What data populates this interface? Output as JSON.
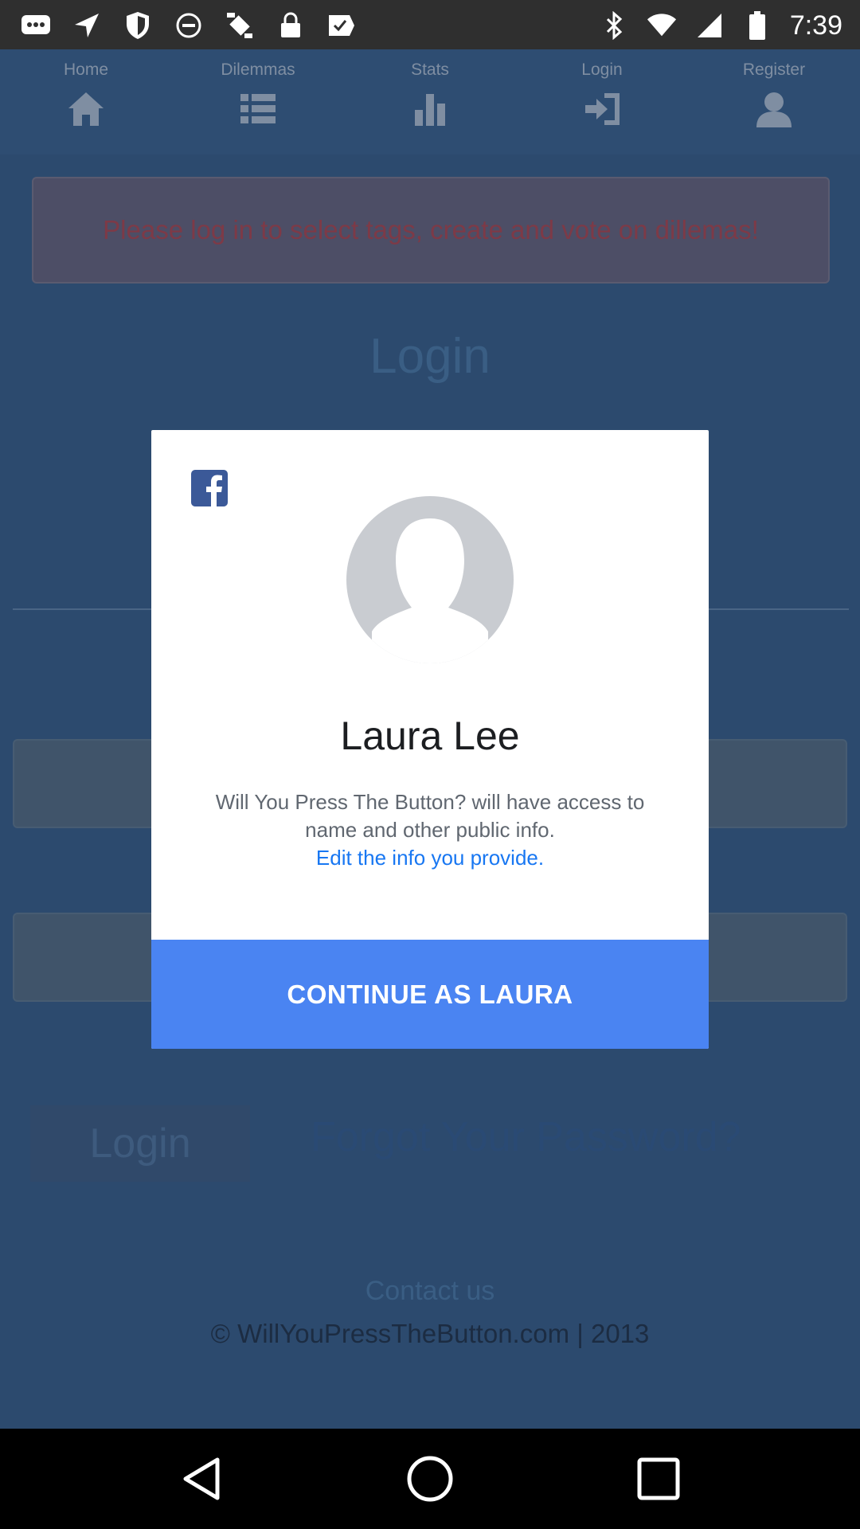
{
  "status_bar": {
    "time": "7:39"
  },
  "nav": [
    {
      "label": "Home",
      "icon": "home-icon"
    },
    {
      "label": "Dilemmas",
      "icon": "list-icon"
    },
    {
      "label": "Stats",
      "icon": "bar-chart-icon"
    },
    {
      "label": "Login",
      "icon": "sign-in-icon"
    },
    {
      "label": "Register",
      "icon": "user-icon"
    }
  ],
  "alert": {
    "message": "Please log in to select tags, create and vote on dillemas!"
  },
  "page": {
    "heading": "Login",
    "login_button": "Login",
    "forgot_link": "Forgot Your Password?",
    "contact_link": "Contact us",
    "copyright": "© WillYouPressTheButton.com | 2013"
  },
  "dialog": {
    "user_name": "Laura Lee",
    "permission_text": "Will You Press The Button? will have access to name and other public info.",
    "edit_link": "Edit the info you provide.",
    "continue_button": "CONTINUE AS LAURA"
  },
  "colors": {
    "facebook_blue": "#3b5998",
    "continue_blue": "#4a84f2",
    "link_blue": "#1877f2"
  }
}
